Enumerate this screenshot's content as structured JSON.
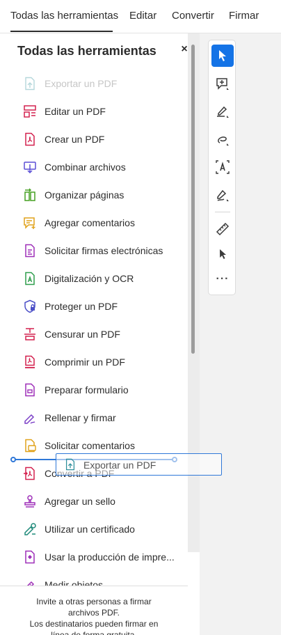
{
  "top_tabs": [
    {
      "label": "Todas las herramientas"
    },
    {
      "label": "Editar"
    },
    {
      "label": "Convertir"
    },
    {
      "label": "Firmar"
    }
  ],
  "panel": {
    "title": "Todas las herramientas",
    "close": "×",
    "tools": [
      {
        "label": "Exportar un PDF",
        "icon": "export-pdf-icon",
        "color": "#2e8f9b"
      },
      {
        "label": "Editar un PDF",
        "icon": "edit-pdf-icon",
        "color": "#d3204e"
      },
      {
        "label": "Crear un PDF",
        "icon": "create-pdf-icon",
        "color": "#d3204e"
      },
      {
        "label": "Combinar archivos",
        "icon": "combine-files-icon",
        "color": "#5b4fd6"
      },
      {
        "label": "Organizar páginas",
        "icon": "organize-pages-icon",
        "color": "#46a022"
      },
      {
        "label": "Agregar comentarios",
        "icon": "add-comment-icon",
        "color": "#e0a21a"
      },
      {
        "label": "Solicitar firmas electrónicas",
        "icon": "request-esign-icon",
        "color": "#9e2fb8"
      },
      {
        "label": "Digitalización y OCR",
        "icon": "scan-ocr-icon",
        "color": "#2f9e4c"
      },
      {
        "label": "Proteger un PDF",
        "icon": "protect-pdf-icon",
        "color": "#4b4fc7"
      },
      {
        "label": "Censurar un PDF",
        "icon": "redact-pdf-icon",
        "color": "#d3204e"
      },
      {
        "label": "Comprimir un PDF",
        "icon": "compress-pdf-icon",
        "color": "#d3204e"
      },
      {
        "label": "Preparar formulario",
        "icon": "prepare-form-icon",
        "color": "#9e2fb8"
      },
      {
        "label": "Rellenar y firmar",
        "icon": "fill-sign-icon",
        "color": "#7b3fc7"
      },
      {
        "label": "Solicitar comentarios",
        "icon": "request-comments-icon",
        "color": "#e0a21a"
      },
      {
        "label": "Convertir a PDF",
        "icon": "convert-pdf-icon",
        "color": "#d3204e"
      },
      {
        "label": "Agregar un sello",
        "icon": "stamp-icon",
        "color": "#9e2fb8"
      },
      {
        "label": "Utilizar un certificado",
        "icon": "certificate-icon",
        "color": "#1f8a7a"
      },
      {
        "label": "Usar la producción de impre...",
        "icon": "print-production-icon",
        "color": "#9e2fb8"
      },
      {
        "label": "Medir objetos",
        "icon": "measure-icon",
        "color": "#9e2fb8"
      }
    ],
    "footer_lines": [
      "Invite a otras personas a firmar",
      "archivos PDF.",
      "Los destinatarios pueden firmar en",
      "línea de forma gratuita."
    ]
  },
  "drag_ghost": {
    "label": "Exportar un PDF",
    "icon": "export-pdf-icon"
  },
  "right_toolbar": {
    "accent": "#1473e6",
    "buttons": [
      {
        "icon": "select-cursor-icon",
        "active": true
      },
      {
        "icon": "add-comment-icon"
      },
      {
        "icon": "highlight-pen-icon"
      },
      {
        "icon": "draw-freehand-icon"
      },
      {
        "icon": "text-recognition-icon"
      },
      {
        "icon": "fill-sign-pen-icon"
      },
      {
        "icon": "measure-ruler-icon"
      },
      {
        "icon": "pointer-cursor-icon"
      }
    ],
    "more_label": "···"
  }
}
